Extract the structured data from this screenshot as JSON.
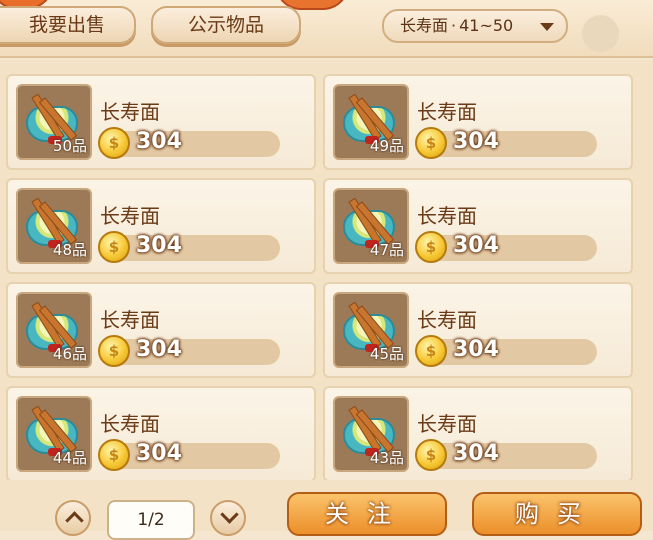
{
  "tabs": {
    "sell": "我要出售",
    "public": "公示物品"
  },
  "filter": {
    "item": "长寿面",
    "separator": "·",
    "level_range": "41~50"
  },
  "items": [
    {
      "name": "长寿面",
      "grade": "50品",
      "price": "304"
    },
    {
      "name": "长寿面",
      "grade": "49品",
      "price": "304"
    },
    {
      "name": "长寿面",
      "grade": "48品",
      "price": "304"
    },
    {
      "name": "长寿面",
      "grade": "47品",
      "price": "304"
    },
    {
      "name": "长寿面",
      "grade": "46品",
      "price": "304"
    },
    {
      "name": "长寿面",
      "grade": "45品",
      "price": "304"
    },
    {
      "name": "长寿面",
      "grade": "44品",
      "price": "304"
    },
    {
      "name": "长寿面",
      "grade": "43品",
      "price": "304"
    }
  ],
  "pagination": {
    "page": "1/2"
  },
  "actions": {
    "follow": "关注",
    "buy": "购买"
  },
  "icons": {
    "coin": "gold-coin-icon",
    "item": "noodle-bowl-icon",
    "prev": "chevron-up-icon",
    "next": "chevron-down-icon",
    "filter_toggle": "caret-down-icon"
  },
  "colors": {
    "text": "#6b3a17",
    "accent": "#eb8f2a",
    "background": "#f5e6cf"
  }
}
